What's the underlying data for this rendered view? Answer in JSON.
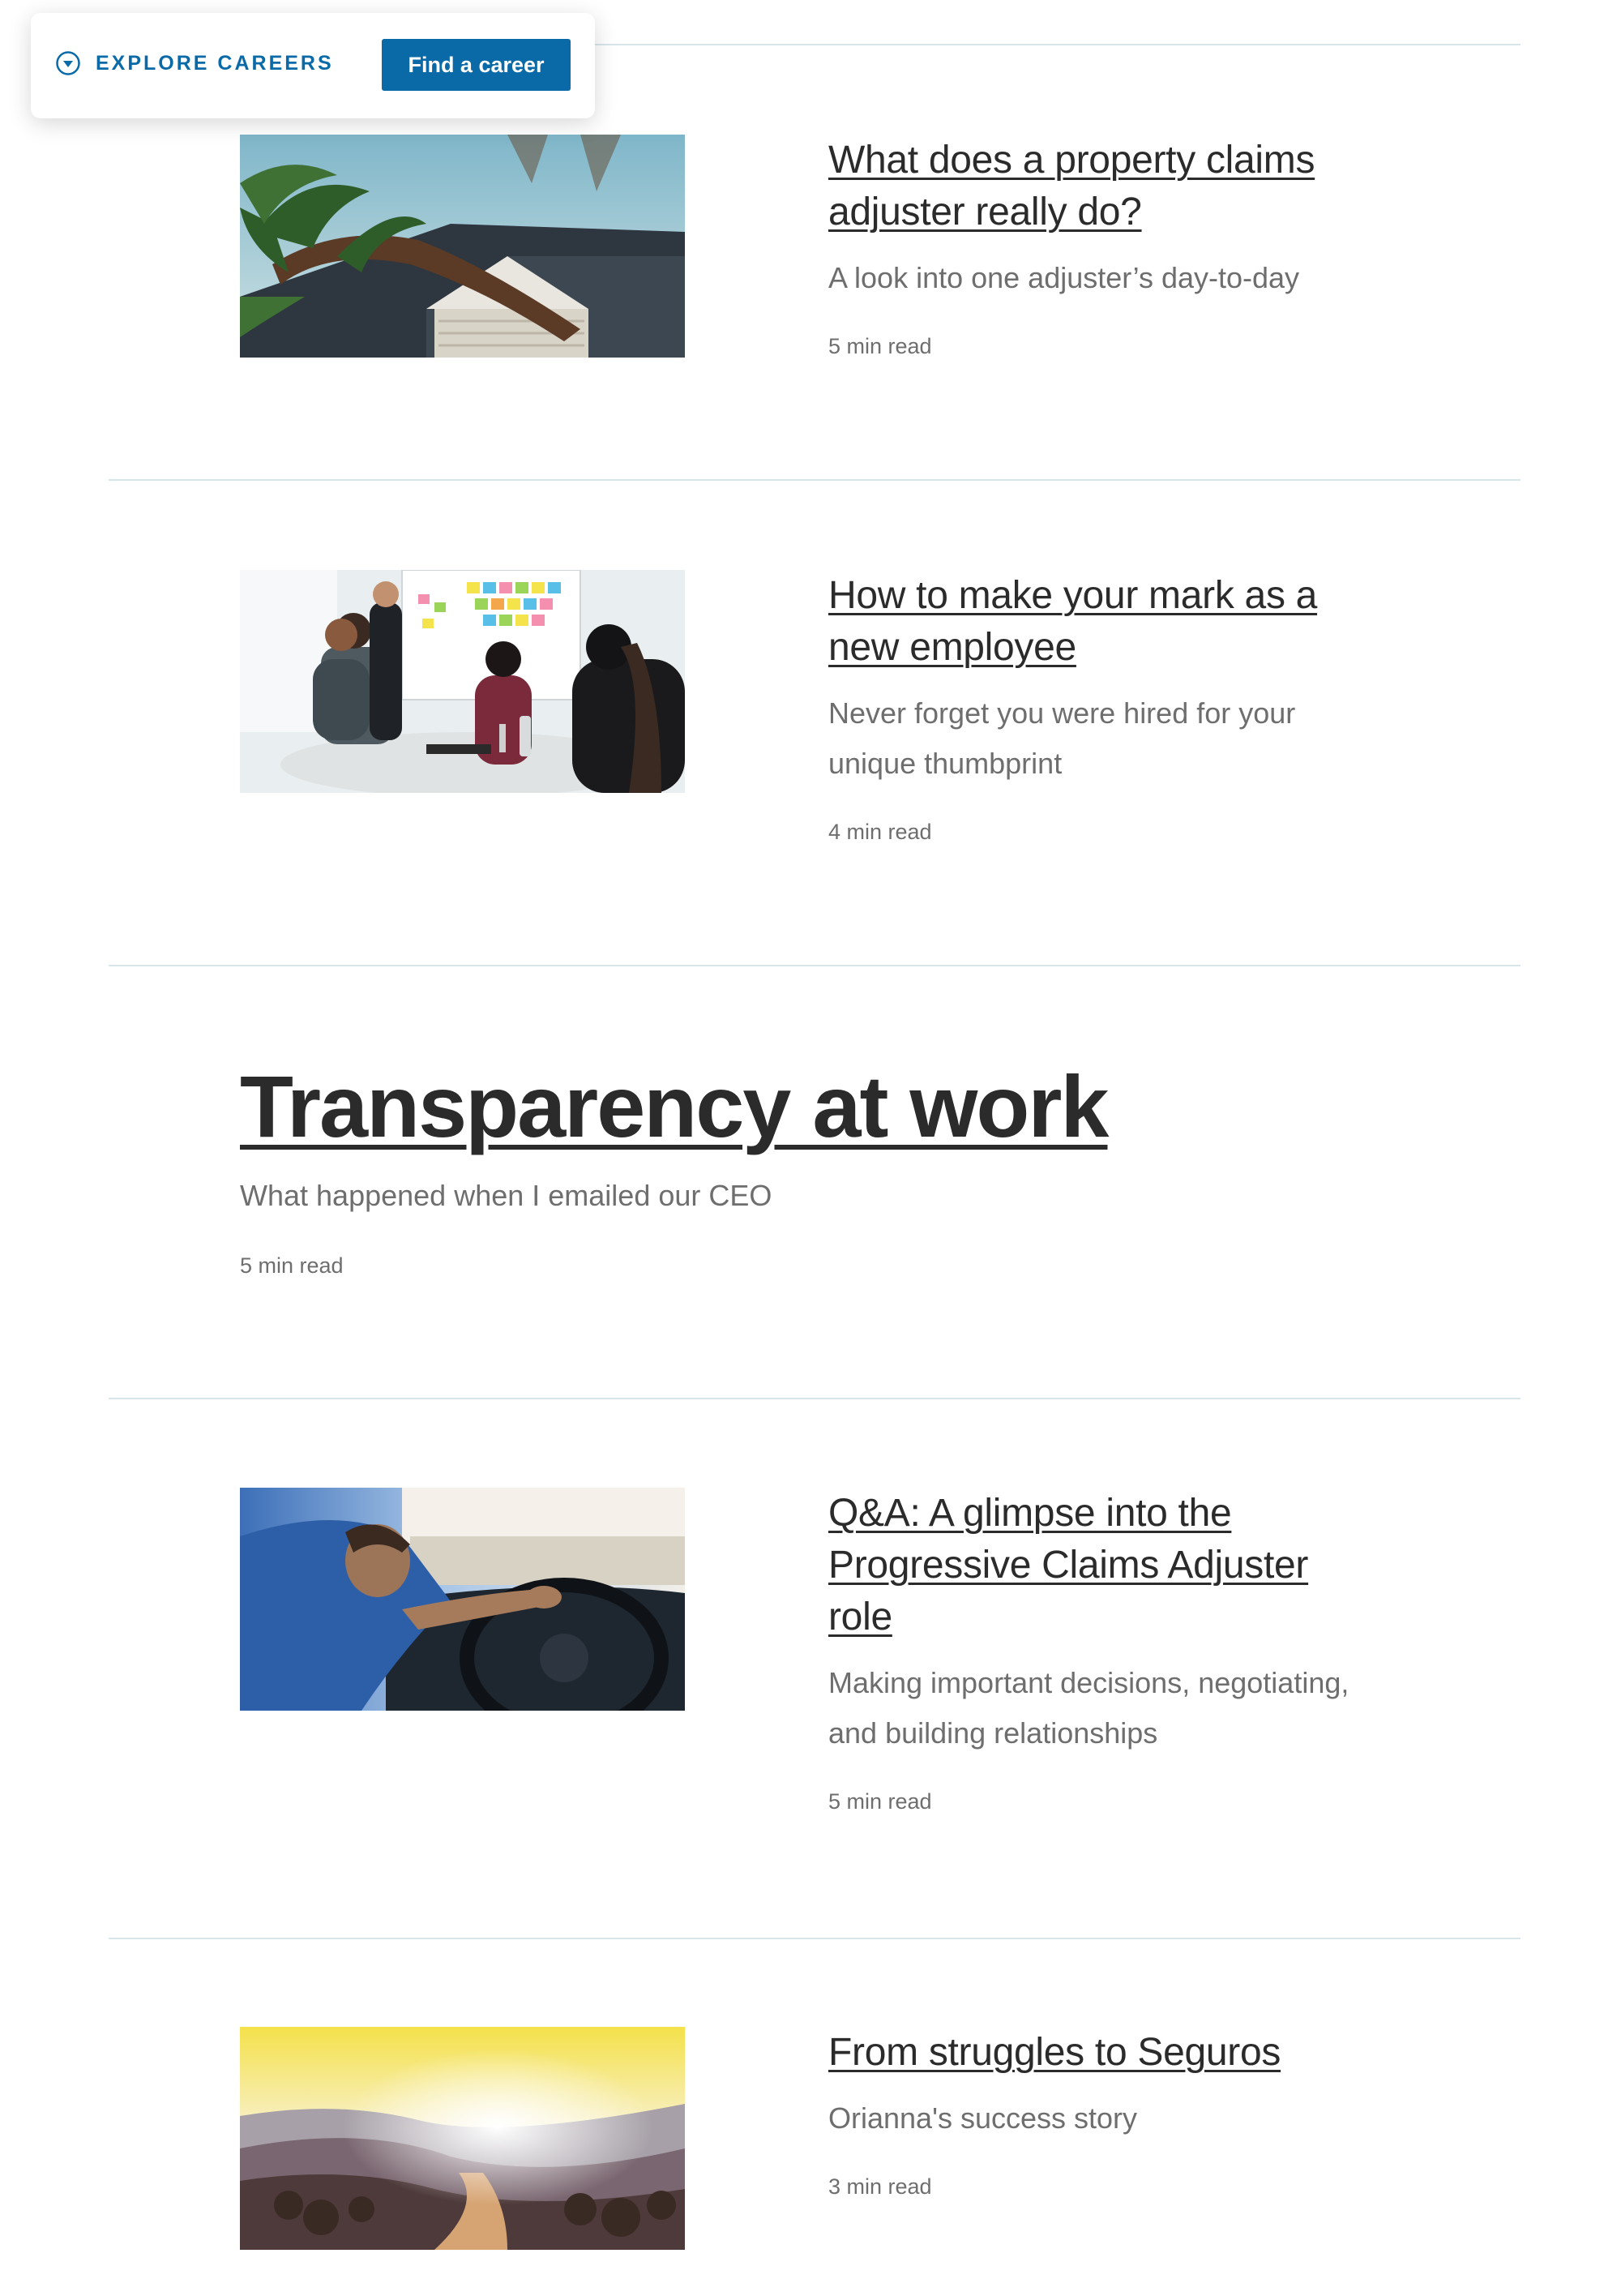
{
  "explore_bar": {
    "toggle_label": "EXPLORE CAREERS",
    "button_label": "Find a career",
    "accent_color": "#0a6aa8"
  },
  "articles": [
    {
      "title": "What does a property claims adjuster really do?",
      "subtitle": "A look into one adjuster’s day-to-day",
      "read_time": "5 min read",
      "image": "storm-damaged-roof-with-fallen-palm-tree"
    },
    {
      "title": "How to make your mark as a new employee",
      "subtitle": "Never forget you were hired for your unique thumbprint",
      "read_time": "4 min read",
      "image": "team-meeting-at-sticky-note-board"
    },
    {
      "title": "Q&A: A glimpse into the Progressive Claims Adjuster role",
      "subtitle": "Making important decisions, negotiating, and building relationships",
      "read_time": "5 min read",
      "image": "person-driving-car"
    },
    {
      "title": "From struggles to Seguros",
      "subtitle": "Orianna's success story",
      "read_time": "3 min read",
      "image": "sunlit-mountain-road"
    }
  ],
  "featured": {
    "title": "Transparency at work",
    "subtitle": "What happened when I emailed our CEO",
    "read_time": "5 min read"
  },
  "colors": {
    "text": "#2b2b2b",
    "muted": "#6e6e6e",
    "divider": "#d7e6ea",
    "brand": "#0a6aa8"
  }
}
